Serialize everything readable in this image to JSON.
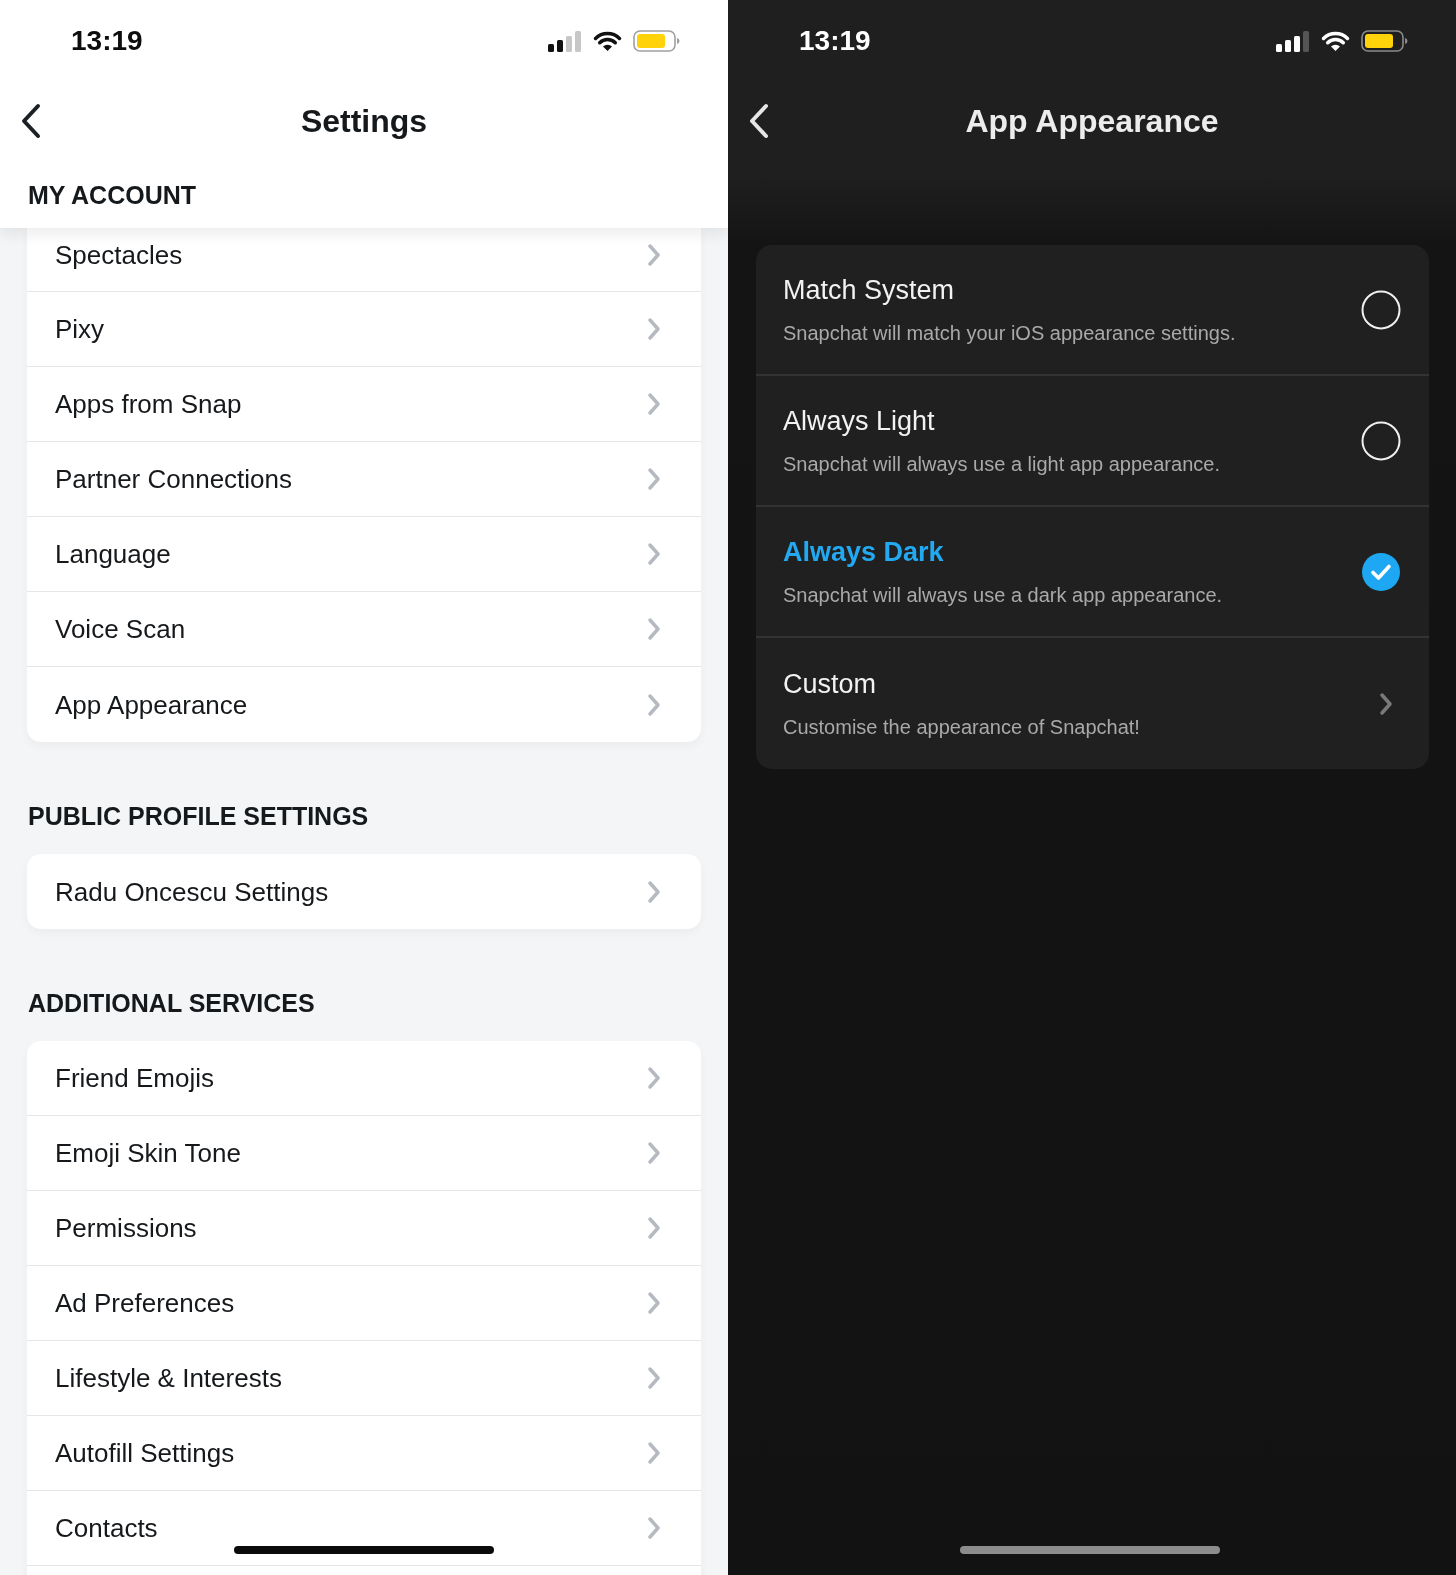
{
  "screens": [
    {
      "kind": "settings_list",
      "status_bar": {
        "time": "13:19"
      },
      "nav_bar": {
        "title": "Settings"
      },
      "sections": [
        {
          "header": "MY ACCOUNT",
          "items": [
            "Spectacles",
            "Pixy",
            "Apps from Snap",
            "Partner Connections",
            "Language",
            "Voice Scan",
            "App Appearance"
          ]
        },
        {
          "header": "PUBLIC PROFILE SETTINGS",
          "items": [
            "Radu Oncescu Settings"
          ]
        },
        {
          "header": "ADDITIONAL SERVICES",
          "items": [
            "Friend Emojis",
            "Emoji Skin Tone",
            "Permissions",
            "Ad Preferences",
            "Lifestyle & Interests",
            "Autofill Settings",
            "Contacts"
          ]
        }
      ]
    },
    {
      "kind": "option_list",
      "status_bar": {
        "time": "13:19"
      },
      "nav_bar": {
        "title": "App Appearance"
      },
      "options": [
        {
          "kind": "radio",
          "title": "Match System",
          "description": "Snapchat will match your iOS appearance settings.",
          "selected": false
        },
        {
          "kind": "radio",
          "title": "Always Light",
          "description": "Snapchat will always use a light app appearance.",
          "selected": false
        },
        {
          "kind": "radio",
          "title": "Always Dark",
          "description": "Snapchat will always use a dark app appearance.",
          "selected": true
        },
        {
          "kind": "link",
          "title": "Custom",
          "description": "Customise the appearance of Snapchat!"
        }
      ]
    }
  ]
}
